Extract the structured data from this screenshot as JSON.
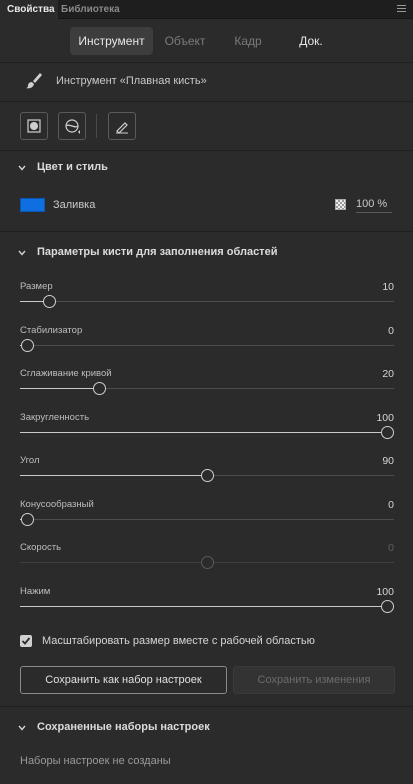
{
  "panel_tabs": {
    "active": "Свойства",
    "inactive": "Библиотека"
  },
  "mode_tabs": [
    "Инструмент",
    "Объект",
    "Кадр",
    "Док."
  ],
  "tool": {
    "icon": "brush-icon",
    "label": "Инструмент «Плавная кисть»"
  },
  "color_section": {
    "title": "Цвет и стиль",
    "fill_label": "Заливка",
    "fill_color": "#0f6fe0",
    "alpha": "100 %"
  },
  "brush_section": {
    "title": "Параметры кисти для заполнения областей",
    "sliders": [
      {
        "label": "Размер",
        "value": "10",
        "level": 0.06,
        "disabled": false
      },
      {
        "label": "Стабилизатор",
        "value": "0",
        "level": 0.0,
        "disabled": false
      },
      {
        "label": "Сглаживание кривой",
        "value": "20",
        "level": 0.2,
        "disabled": false
      },
      {
        "label": "Закругленность",
        "value": "100",
        "level": 1.0,
        "disabled": false
      },
      {
        "label": "Угол",
        "value": "90",
        "level": 0.5,
        "disabled": false
      },
      {
        "label": "Конусообразный",
        "value": "0",
        "level": 0.0,
        "disabled": false
      },
      {
        "label": "Скорость",
        "value": "0",
        "level": 0.5,
        "disabled": true
      },
      {
        "label": "Нажим",
        "value": "100",
        "level": 1.0,
        "disabled": false
      }
    ],
    "scale_checkbox": {
      "label": "Масштабировать размер вместе с рабочей областью",
      "checked": true
    },
    "save_preset_button": "Сохранить как набор настроек",
    "save_changes_button": "Сохранить изменения"
  },
  "presets_section": {
    "title": "Сохраненные наборы настроек",
    "empty_text": "Наборы настроек не созданы"
  }
}
